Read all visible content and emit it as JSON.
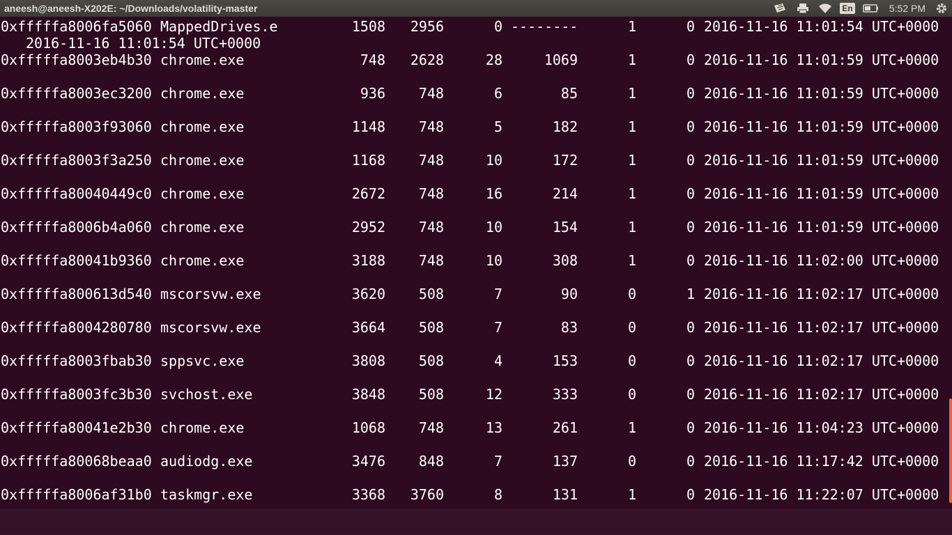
{
  "window": {
    "title": "aneesh@aneesh-X202E: ~/Downloads/volatility-master"
  },
  "indicators": {
    "keyboard_icon": "keyboard-icon",
    "printer_icon": "printer-icon",
    "wifi_icon": "wifi-icon",
    "language": "En",
    "battery_icon": "battery-icon",
    "clock": "5:52 PM",
    "settings_icon": "gear-icon"
  },
  "colors": {
    "terminal_bg": "#2d0a20",
    "text": "#ffffff",
    "topbar_bg": "#3c3b37",
    "scroll_thumb": "#e46a3a"
  },
  "rows": [
    {
      "offset": "0xfffffa8006fa5060",
      "name": "MappedDrives.e",
      "pid": "1508",
      "ppid": "2956",
      "thds": "0",
      "hnds": "--------",
      "sess": "1",
      "wow64": "0",
      "start": "2016-11-16 11:01:54 UTC+0000",
      "cont": "2016-11-16 11:01:54 UTC+0000"
    },
    {
      "offset": "0xfffffa8003eb4b30",
      "name": "chrome.exe",
      "pid": "748",
      "ppid": "2628",
      "thds": "28",
      "hnds": "1069",
      "sess": "1",
      "wow64": "0",
      "start": "2016-11-16 11:01:59 UTC+0000"
    },
    {
      "offset": "0xfffffa8003ec3200",
      "name": "chrome.exe",
      "pid": "936",
      "ppid": "748",
      "thds": "6",
      "hnds": "85",
      "sess": "1",
      "wow64": "0",
      "start": "2016-11-16 11:01:59 UTC+0000"
    },
    {
      "offset": "0xfffffa8003f93060",
      "name": "chrome.exe",
      "pid": "1148",
      "ppid": "748",
      "thds": "5",
      "hnds": "182",
      "sess": "1",
      "wow64": "0",
      "start": "2016-11-16 11:01:59 UTC+0000"
    },
    {
      "offset": "0xfffffa8003f3a250",
      "name": "chrome.exe",
      "pid": "1168",
      "ppid": "748",
      "thds": "10",
      "hnds": "172",
      "sess": "1",
      "wow64": "0",
      "start": "2016-11-16 11:01:59 UTC+0000"
    },
    {
      "offset": "0xfffffa80040449c0",
      "name": "chrome.exe",
      "pid": "2672",
      "ppid": "748",
      "thds": "16",
      "hnds": "214",
      "sess": "1",
      "wow64": "0",
      "start": "2016-11-16 11:01:59 UTC+0000"
    },
    {
      "offset": "0xfffffa8006b4a060",
      "name": "chrome.exe",
      "pid": "2952",
      "ppid": "748",
      "thds": "10",
      "hnds": "154",
      "sess": "1",
      "wow64": "0",
      "start": "2016-11-16 11:01:59 UTC+0000"
    },
    {
      "offset": "0xfffffa80041b9360",
      "name": "chrome.exe",
      "pid": "3188",
      "ppid": "748",
      "thds": "10",
      "hnds": "308",
      "sess": "1",
      "wow64": "0",
      "start": "2016-11-16 11:02:00 UTC+0000"
    },
    {
      "offset": "0xfffffa800613d540",
      "name": "mscorsvw.exe",
      "pid": "3620",
      "ppid": "508",
      "thds": "7",
      "hnds": "90",
      "sess": "0",
      "wow64": "1",
      "start": "2016-11-16 11:02:17 UTC+0000"
    },
    {
      "offset": "0xfffffa8004280780",
      "name": "mscorsvw.exe",
      "pid": "3664",
      "ppid": "508",
      "thds": "7",
      "hnds": "83",
      "sess": "0",
      "wow64": "0",
      "start": "2016-11-16 11:02:17 UTC+0000"
    },
    {
      "offset": "0xfffffa8003fbab30",
      "name": "sppsvc.exe",
      "pid": "3808",
      "ppid": "508",
      "thds": "4",
      "hnds": "153",
      "sess": "0",
      "wow64": "0",
      "start": "2016-11-16 11:02:17 UTC+0000"
    },
    {
      "offset": "0xfffffa8003fc3b30",
      "name": "svchost.exe",
      "pid": "3848",
      "ppid": "508",
      "thds": "12",
      "hnds": "333",
      "sess": "0",
      "wow64": "0",
      "start": "2016-11-16 11:02:17 UTC+0000"
    },
    {
      "offset": "0xfffffa80041e2b30",
      "name": "chrome.exe",
      "pid": "1068",
      "ppid": "748",
      "thds": "13",
      "hnds": "261",
      "sess": "1",
      "wow64": "0",
      "start": "2016-11-16 11:04:23 UTC+0000"
    },
    {
      "offset": "0xfffffa80068beaa0",
      "name": "audiodg.exe",
      "pid": "3476",
      "ppid": "848",
      "thds": "7",
      "hnds": "137",
      "sess": "0",
      "wow64": "0",
      "start": "2016-11-16 11:17:42 UTC+0000"
    },
    {
      "offset": "0xfffffa8006af31b0",
      "name": "taskmgr.exe",
      "pid": "3368",
      "ppid": "3760",
      "thds": "8",
      "hnds": "131",
      "sess": "1",
      "wow64": "0",
      "start": "2016-11-16 11:22:07 UTC+0000"
    }
  ]
}
